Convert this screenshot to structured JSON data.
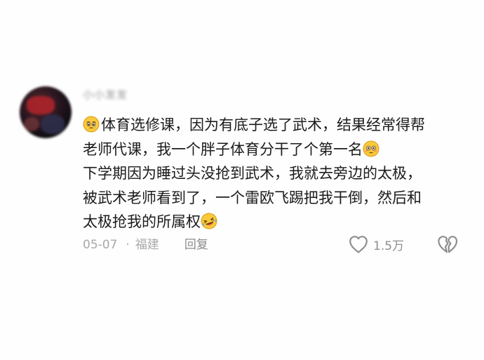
{
  "comment": {
    "username": "小小发发",
    "lines": [
      "体育选修课，因为有底子选了武术，结果经常得帮",
      "老师代课，我一个胖子体育分干了个第一名",
      "下学期因为睡过头没抢到武术，我就去旁边的太极，",
      "被武术老师看到了，一个雷欧飞踢把我干倒，然后和",
      "太极抢我的所属权"
    ],
    "emojis": [
      "pleading-face-emoji",
      "flushed-face-emoji",
      "laughing-tears-emoji"
    ]
  },
  "meta": {
    "date": "05-07",
    "separator": "·",
    "location": "福建",
    "reply_label": "回复"
  },
  "actions": {
    "like_count": "1.5万",
    "like_icon": "heart-outline-icon",
    "dislike_icon": "broken-heart-icon"
  },
  "colors": {
    "text": "#1b1b1b",
    "meta": "#a8a8a8",
    "icon": "#8e8e8e",
    "emoji_yellow": "#f9c93a"
  }
}
